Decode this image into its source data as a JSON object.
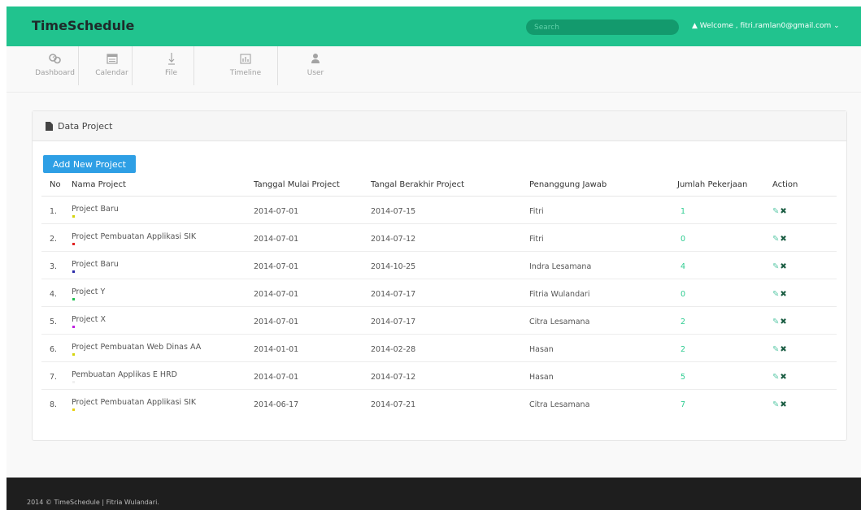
{
  "app": {
    "title": "TimeSchedule"
  },
  "header": {
    "search_placeholder": "Search",
    "welcome_text": "▲ Welcome , fitri.ramlan0@gmail.com ⌄"
  },
  "nav": {
    "items": [
      {
        "label": "Dashboard",
        "icon": "dashboard-icon"
      },
      {
        "label": "Calendar",
        "icon": "calendar-icon"
      },
      {
        "label": "File",
        "icon": "file-download-icon"
      },
      {
        "label": "Timeline",
        "icon": "timeline-chart-icon"
      },
      {
        "label": "User",
        "icon": "user-icon"
      }
    ]
  },
  "panel": {
    "title": "Data Project",
    "add_button_label": "Add New Project"
  },
  "table": {
    "headers": [
      "No",
      "Nama Project",
      "Tanggal Mulai Project",
      "Tangal Berakhir Project",
      "Penanggung Jawab",
      "Jumlah Pekerjaan",
      "Action"
    ],
    "rows": [
      {
        "no": "1.",
        "name": "Project Baru",
        "start": "2014-07-01",
        "end": "2014-07-15",
        "pic": "Fitri",
        "jobs": "1",
        "color": "#d4d40c"
      },
      {
        "no": "2.",
        "name": "Project Pembuatan Applikasi SIK",
        "start": "2014-07-01",
        "end": "2014-07-12",
        "pic": "Fitri",
        "jobs": "0",
        "color": "#e02020"
      },
      {
        "no": "3.",
        "name": "Project Baru",
        "start": "2014-07-01",
        "end": "2014-10-25",
        "pic": "Indra Lesamana",
        "jobs": "4",
        "color": "#2a2aa8"
      },
      {
        "no": "4.",
        "name": "Project Y",
        "start": "2014-07-01",
        "end": "2014-07-17",
        "pic": "Fitria Wulandari",
        "jobs": "0",
        "color": "#20c050"
      },
      {
        "no": "5.",
        "name": "Project X",
        "start": "2014-07-01",
        "end": "2014-07-17",
        "pic": "Citra Lesamana",
        "jobs": "2",
        "color": "#c020e0"
      },
      {
        "no": "6.",
        "name": "Project Pembuatan Web Dinas AA",
        "start": "2014-01-01",
        "end": "2014-02-28",
        "pic": "Hasan",
        "jobs": "2",
        "color": "#d4d40c"
      },
      {
        "no": "7.",
        "name": "Pembuatan Applikas E HRD",
        "start": "2014-07-01",
        "end": "2014-07-12",
        "pic": "Hasan",
        "jobs": "5",
        "color": "#f0f0f0"
      },
      {
        "no": "8.",
        "name": "Project Pembuatan Applikasi SIK",
        "start": "2014-06-17",
        "end": "2014-07-21",
        "pic": "Citra Lesamana",
        "jobs": "7",
        "color": "#e8d010"
      }
    ],
    "action_icons": [
      "edit-icon",
      "delete-icon"
    ]
  },
  "footer": {
    "text": "2014 © TimeSchedule | Fitria Wulandari."
  },
  "colors": {
    "primary_green": "#21c38e",
    "count_green": "#2ecc91",
    "button_blue": "#2e9fe5",
    "footer_bg": "#1e1e1e"
  }
}
